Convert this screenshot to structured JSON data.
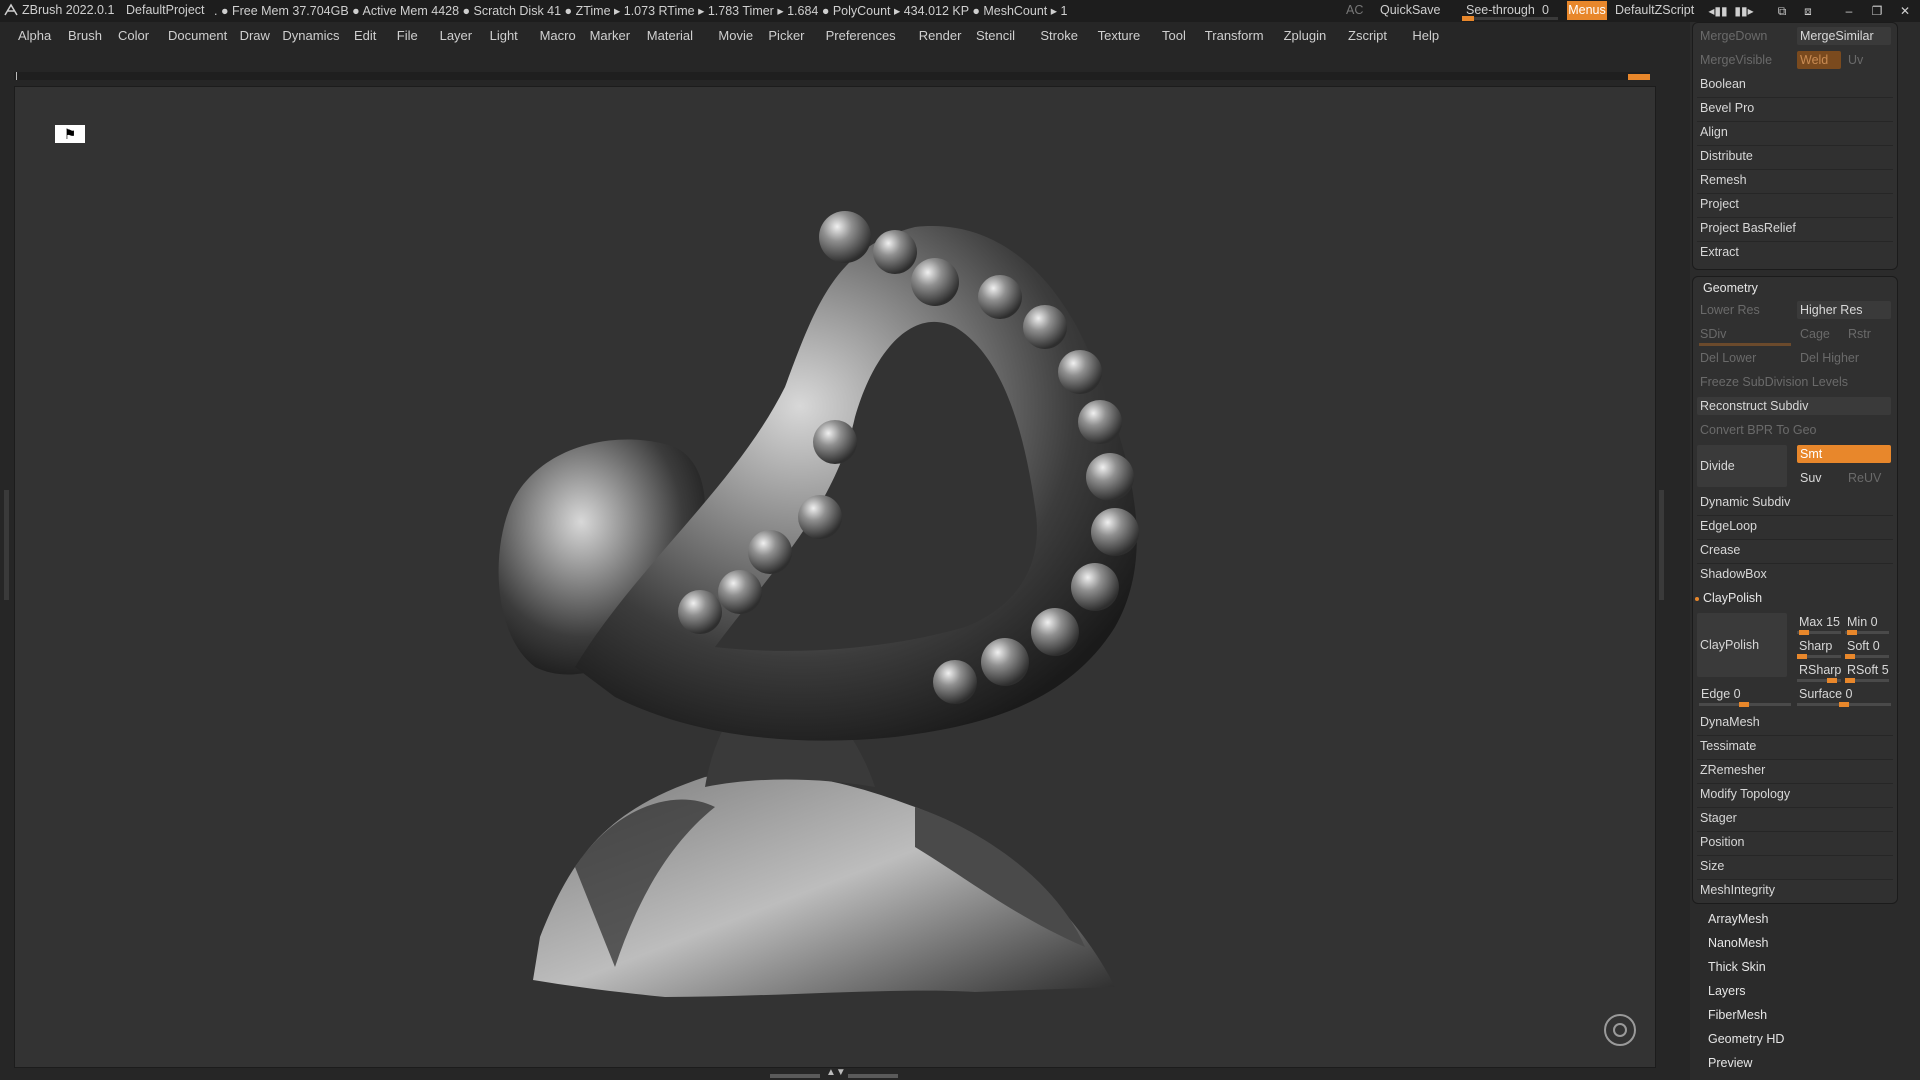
{
  "titlebar": {
    "app_name": "ZBrush 2022.0.1",
    "project": "DefaultProject",
    "status": ". ● Free Mem 37.704GB ● Active Mem 4428 ● Scratch Disk 41 ●  ZTime ▸ 1.073 RTime ▸ 1.783 Timer ▸ 1.684 ● PolyCount ▸ 434.012 KP  ● MeshCount ▸ 1",
    "ac": "AC",
    "quicksave": "QuickSave",
    "see_through_label": "See-through",
    "see_through_value": "0",
    "see_through_level": 0,
    "menus": "Menus",
    "zscript": "DefaultZScript",
    "accent": "#e8872b"
  },
  "menubar": [
    "Alpha",
    "Brush",
    "Color",
    "Document",
    "Draw",
    "Dynamics",
    "Edit",
    "File",
    "Layer",
    "Light",
    "Macro",
    "Marker",
    "Material",
    "Movie",
    "Picker",
    "Preferences",
    "Render",
    "Stencil",
    "Stroke",
    "Texture",
    "Tool",
    "Transform",
    "Zplugin",
    "Zscript",
    "Help"
  ],
  "subtool_group": {
    "merge_down": "MergeDown",
    "merge_similar": "MergeSimilar",
    "merge_visible": "MergeVisible",
    "weld": "Weld",
    "uv": "Uv",
    "items": [
      "Boolean",
      "Bevel Pro",
      "Align",
      "Distribute",
      "Remesh",
      "Project",
      "Project BasRelief",
      "Extract"
    ]
  },
  "geometry": {
    "title": "Geometry",
    "lower_res": "Lower Res",
    "higher_res": "Higher Res",
    "sdiv": "SDiv",
    "cage": "Cage",
    "rstr": "Rstr",
    "del_lower": "Del Lower",
    "del_higher": "Del Higher",
    "freeze": "Freeze SubDivision Levels",
    "reconstruct": "Reconstruct Subdiv",
    "convert_bpr": "Convert BPR To Geo",
    "divide": "Divide",
    "smt": "Smt",
    "suv": "Suv",
    "reuv": "ReUV",
    "items_a": [
      "Dynamic Subdiv",
      "EdgeLoop",
      "Crease",
      "ShadowBox"
    ],
    "claypolish_header": "ClayPolish",
    "claypolish_btn": "ClayPolish",
    "max": "Max 15",
    "min": "Min 0",
    "sharp": "Sharp",
    "soft": "Soft 0",
    "rsharp": "RSharp",
    "rsoft": "RSoft 5",
    "edge": "Edge 0",
    "surface": "Surface 0",
    "items_b": [
      "DynaMesh",
      "Tessimate",
      "ZRemesher",
      "Modify Topology",
      "Stager",
      "Position",
      "Size",
      "MeshIntegrity"
    ]
  },
  "tool_sections": [
    "ArrayMesh",
    "NanoMesh",
    "Thick Skin",
    "Layers",
    "FiberMesh",
    "Geometry HD",
    "Preview"
  ]
}
